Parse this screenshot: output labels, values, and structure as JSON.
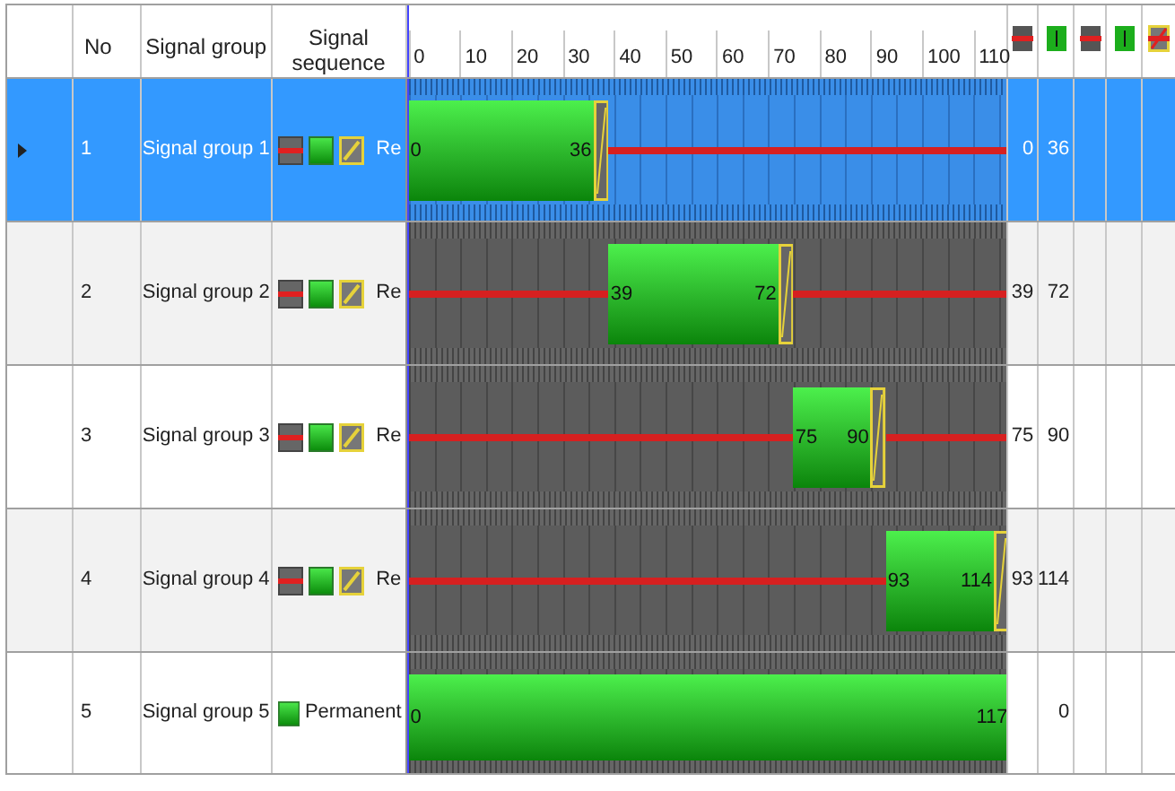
{
  "table": {
    "columns": [
      "No",
      "Signal group",
      "Signal sequence"
    ],
    "timeline_ticks": [
      "0",
      "10",
      "20",
      "30",
      "40",
      "50",
      "60",
      "70",
      "80",
      "90",
      "100",
      "110"
    ],
    "header_icons": [
      {
        "kind": "stop"
      },
      {
        "kind": "go-down"
      },
      {
        "kind": "stop"
      },
      {
        "kind": "go-down"
      },
      {
        "kind": "stop-clearance"
      }
    ],
    "rows": [
      {
        "no": "1",
        "name": "Signal group 1",
        "kind": "cycle",
        "sequence": [
          {
            "kind": "stop"
          },
          {
            "kind": "go"
          },
          {
            "kind": "clearance"
          }
        ],
        "sequence_label": "Re",
        "green_start": "0",
        "green_end": "36",
        "column_1": "0",
        "column_2": "36",
        "selected": true
      },
      {
        "no": "2",
        "name": "Signal group 2",
        "kind": "cycle",
        "sequence": [
          {
            "kind": "stop"
          },
          {
            "kind": "go"
          },
          {
            "kind": "clearance"
          }
        ],
        "sequence_label": "Re",
        "green_start": "39",
        "green_end": "72",
        "column_1": "39",
        "column_2": "72",
        "selected": false
      },
      {
        "no": "3",
        "name": "Signal group 3",
        "kind": "cycle",
        "sequence": [
          {
            "kind": "stop"
          },
          {
            "kind": "go"
          },
          {
            "kind": "clearance"
          }
        ],
        "sequence_label": "Re",
        "green_start": "75",
        "green_end": "90",
        "column_1": "75",
        "column_2": "90",
        "selected": false
      },
      {
        "no": "4",
        "name": "Signal group 4",
        "kind": "cycle",
        "sequence": [
          {
            "kind": "stop"
          },
          {
            "kind": "go"
          },
          {
            "kind": "clearance"
          }
        ],
        "sequence_label": "Re",
        "green_start": "93",
        "green_end": "114",
        "column_1": "93",
        "column_2": "114",
        "selected": false
      },
      {
        "no": "5",
        "name": "Signal group 5",
        "kind": "permanent",
        "sequence": [
          {
            "kind": "go"
          }
        ],
        "sequence_label": "Permanent",
        "green_start": "0",
        "green_end": "117",
        "column_2": "0",
        "selected": false
      }
    ]
  }
}
